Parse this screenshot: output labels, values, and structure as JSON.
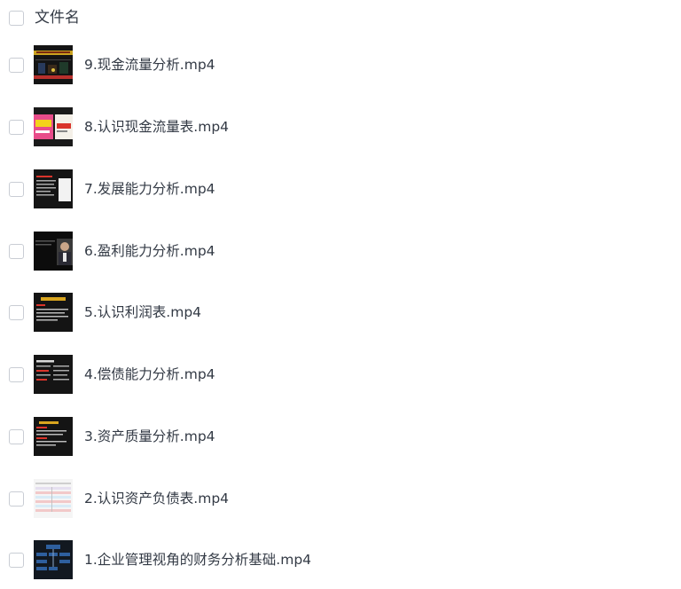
{
  "header": {
    "column_label": "文件名"
  },
  "files": [
    {
      "name": "9.现金流量分析.mp4",
      "thumbnail": "video-thumbnail-cash-flow-analysis"
    },
    {
      "name": "8.认识现金流量表.mp4",
      "thumbnail": "video-thumbnail-cash-flow-statement"
    },
    {
      "name": "7.发展能力分析.mp4",
      "thumbnail": "video-thumbnail-growth-ability"
    },
    {
      "name": "6.盈利能力分析.mp4",
      "thumbnail": "video-thumbnail-profitability"
    },
    {
      "name": "5.认识利润表.mp4",
      "thumbnail": "video-thumbnail-income-statement"
    },
    {
      "name": "4.偿债能力分析.mp4",
      "thumbnail": "video-thumbnail-solvency"
    },
    {
      "name": "3.资产质量分析.mp4",
      "thumbnail": "video-thumbnail-asset-quality"
    },
    {
      "name": "2.认识资产负债表.mp4",
      "thumbnail": "video-thumbnail-balance-sheet"
    },
    {
      "name": "1.企业管理视角的财务分析基础.mp4",
      "thumbnail": "video-thumbnail-financial-analysis-basics"
    }
  ]
}
